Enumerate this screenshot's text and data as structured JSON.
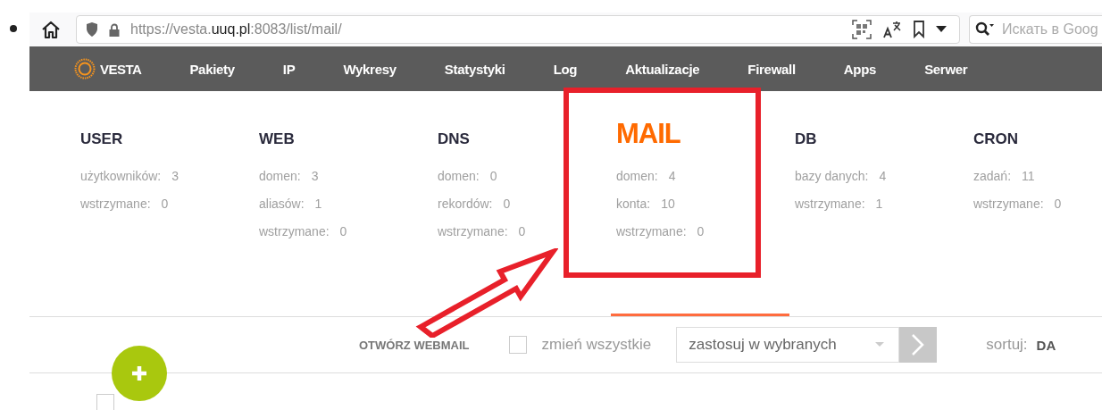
{
  "browser": {
    "url": {
      "before": "https://vesta.",
      "domain": "uuq.pl",
      "after": ":8083/list/mail/"
    },
    "search": {
      "placeholder": "Искать в Goog"
    }
  },
  "nav": {
    "logo": "VESTA",
    "items": [
      "Pakiety",
      "IP",
      "Wykresy",
      "Statystyki",
      "Log",
      "Aktualizacje",
      "Firewall",
      "Apps",
      "Serwer"
    ]
  },
  "tabs": [
    {
      "title": "USER",
      "selected": false,
      "stats": [
        {
          "label": "użytkowników:",
          "value": "3"
        },
        {
          "label": "wstrzymane:",
          "value": "0"
        }
      ]
    },
    {
      "title": "WEB",
      "selected": false,
      "stats": [
        {
          "label": "domen:",
          "value": "3"
        },
        {
          "label": "aliasów:",
          "value": "1"
        },
        {
          "label": "wstrzymane:",
          "value": "0"
        }
      ]
    },
    {
      "title": "DNS",
      "selected": false,
      "stats": [
        {
          "label": "domen:",
          "value": "0"
        },
        {
          "label": "rekordów:",
          "value": "0"
        },
        {
          "label": "wstrzymane:",
          "value": "0"
        }
      ]
    },
    {
      "title": "MAIL",
      "selected": true,
      "stats": [
        {
          "label": "domen:",
          "value": "4"
        },
        {
          "label": "konta:",
          "value": "10"
        },
        {
          "label": "wstrzymane:",
          "value": "0"
        }
      ]
    },
    {
      "title": "DB",
      "selected": false,
      "stats": [
        {
          "label": "bazy danych:",
          "value": "4"
        },
        {
          "label": "wstrzymane:",
          "value": "1"
        }
      ]
    },
    {
      "title": "CRON",
      "selected": false,
      "stats": [
        {
          "label": "zadań:",
          "value": "11"
        },
        {
          "label": "wstrzymane:",
          "value": "0"
        }
      ]
    }
  ],
  "toolbar": {
    "webmail": "OTWÓRZ WEBMAIL",
    "select_all": {
      "label": "zmień wszystkie",
      "checked": false
    },
    "action": "zastosuj w wybranych",
    "sort_label": "sortuj:",
    "sort_value": "DA"
  },
  "list": {
    "row_checked": false
  }
}
